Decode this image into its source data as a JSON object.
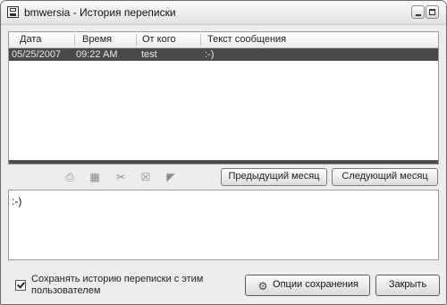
{
  "window": {
    "title": "bmwersia - История переписки"
  },
  "list": {
    "columns": [
      "Дата",
      "Время",
      "От кого",
      "Текст сообщения"
    ],
    "rows": [
      {
        "date": "05/25/2007",
        "time": "09:22 AM",
        "from": "test",
        "text": ":-)"
      }
    ]
  },
  "toolbar": {
    "icons": [
      "print-icon",
      "save-icon",
      "cut-icon",
      "delete-icon",
      "open-folder-icon"
    ],
    "prev_month_label": "Предыдущий месяц",
    "next_month_label": "Следующий месяц"
  },
  "message": {
    "text": ":-)"
  },
  "footer": {
    "save_history_label": "Сохранять историю переписки с этим пользователем",
    "save_history_checked": true,
    "options_label": "Опции сохранения",
    "close_label": "Закрыть"
  }
}
